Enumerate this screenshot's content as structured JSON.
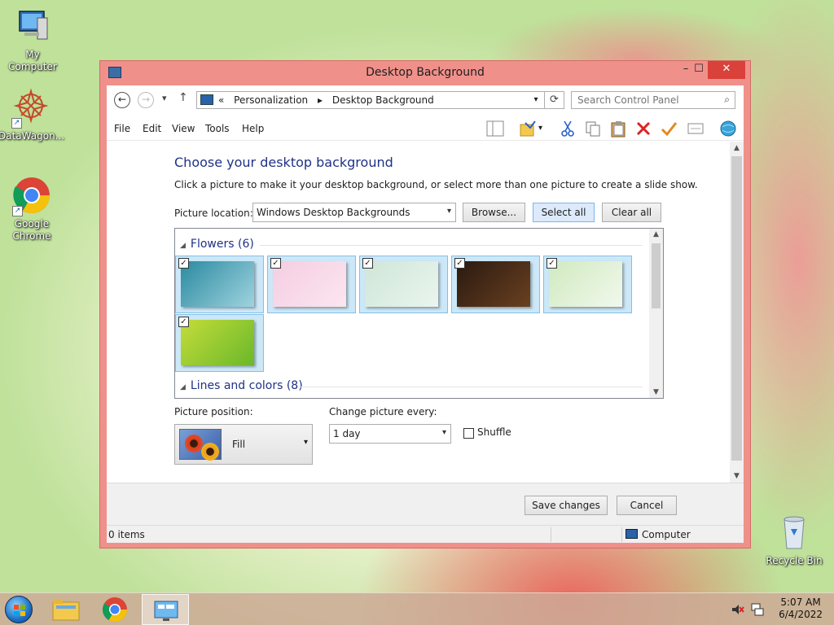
{
  "desktop": {
    "icons": [
      {
        "label": "My Computer"
      },
      {
        "label": "DataWagon..."
      },
      {
        "label": "Google Chrome"
      },
      {
        "label": "Recycle Bin"
      }
    ]
  },
  "window": {
    "title": "Desktop Background",
    "controls": {
      "minimize": "–",
      "maximize": "☐",
      "close": "✕"
    },
    "address": {
      "prefix": "«",
      "crumbs": [
        "Personalization",
        "Desktop Background"
      ]
    },
    "search": {
      "placeholder": "Search Control Panel"
    },
    "menu": [
      "File",
      "Edit",
      "View",
      "Tools",
      "Help"
    ],
    "toolbar_icons": [
      "layout-icon",
      "folder-properties-icon",
      "cut-icon",
      "copy-icon",
      "paste-icon",
      "delete-icon",
      "checkmark-icon",
      "email-icon",
      "globe-icon"
    ]
  },
  "content": {
    "heading": "Choose your desktop background",
    "subtext": "Click a picture to make it your desktop background, or select more than one picture to create a slide show.",
    "picture_location": {
      "label": "Picture location:",
      "value": "Windows Desktop Backgrounds"
    },
    "buttons": {
      "browse": "Browse...",
      "select_all": "Select all",
      "clear_all": "Clear all"
    },
    "groups": [
      {
        "title": "Flowers (6)",
        "items": [
          {
            "checked": "✓",
            "colors": [
              "#2a8aa0",
              "#9fd3df"
            ]
          },
          {
            "checked": "✓",
            "colors": [
              "#f5cde2",
              "#fbe6ef"
            ]
          },
          {
            "checked": "✓",
            "colors": [
              "#cfe6d8",
              "#eaf5ee"
            ]
          },
          {
            "checked": "✓",
            "colors": [
              "#2a1a10",
              "#6a4020"
            ]
          },
          {
            "checked": "✓",
            "colors": [
              "#cfeac0",
              "#f2f8ec"
            ]
          },
          {
            "checked": "✓",
            "colors": [
              "#c4dc3a",
              "#6ab82a"
            ]
          }
        ]
      },
      {
        "title": "Lines and colors (8)"
      }
    ],
    "picture_position": {
      "label": "Picture position:",
      "value": "Fill"
    },
    "change_every": {
      "label": "Change picture every:",
      "value": "1 day"
    },
    "shuffle": {
      "label": "Shuffle",
      "checked": false
    }
  },
  "footer": {
    "save": "Save changes",
    "cancel": "Cancel"
  },
  "status": {
    "items": "0 items",
    "location": "Computer"
  },
  "taskbar": {
    "time": "5:07 AM",
    "date": "6/4/2022"
  }
}
